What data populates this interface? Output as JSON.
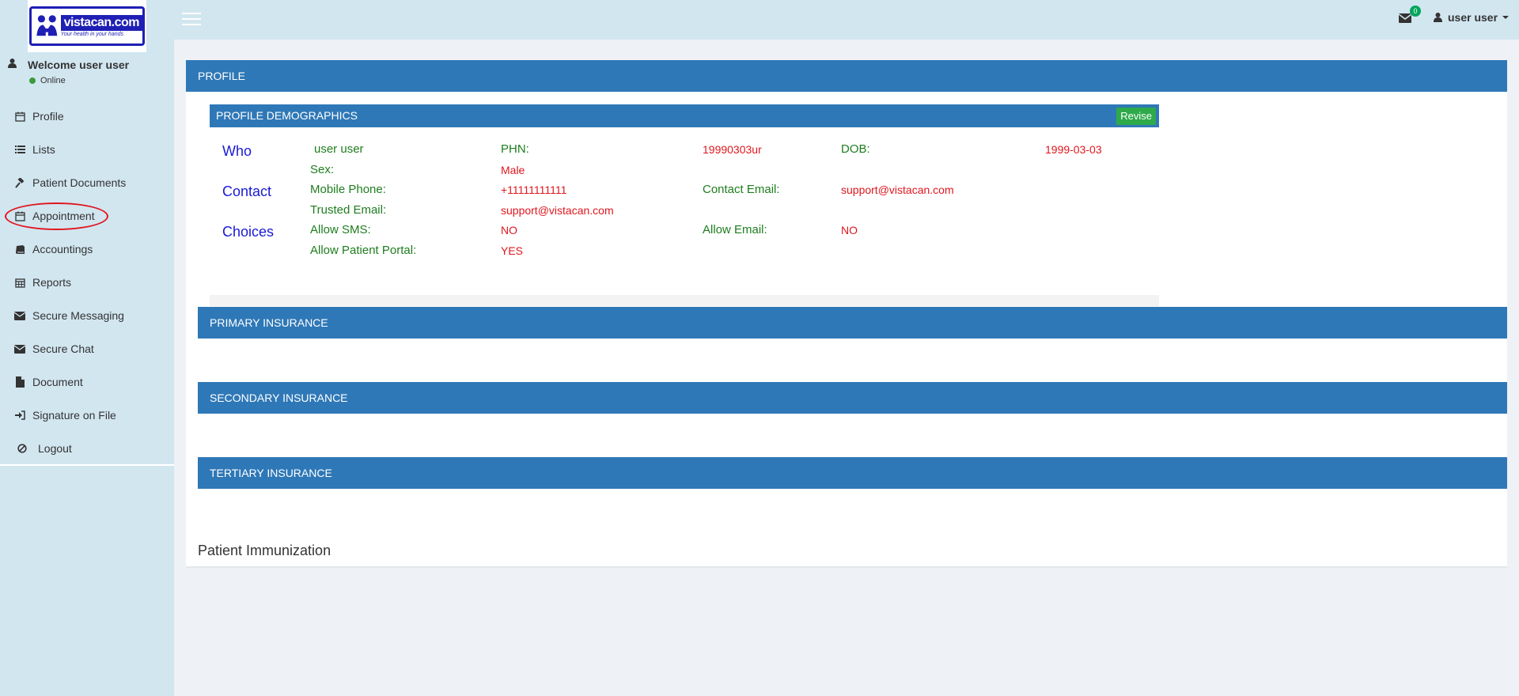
{
  "header": {
    "logo": {
      "brand": "vistacan.com",
      "tagline": "Your health in your hands"
    },
    "notifications_count": "0",
    "user_name": "user user"
  },
  "sidebar": {
    "welcome": "Welcome user user",
    "status": "Online",
    "items": [
      {
        "label": "Profile",
        "icon": "calendar-icon"
      },
      {
        "label": "Lists",
        "icon": "list-icon"
      },
      {
        "label": "Patient Documents",
        "icon": "gavel-icon"
      },
      {
        "label": "Appointment",
        "icon": "calendar-icon"
      },
      {
        "label": "Accountings",
        "icon": "book-icon"
      },
      {
        "label": "Reports",
        "icon": "calendar-grid-icon"
      },
      {
        "label": "Secure Messaging",
        "icon": "envelope-icon"
      },
      {
        "label": "Secure Chat",
        "icon": "envelope-icon"
      },
      {
        "label": "Document",
        "icon": "file-icon"
      },
      {
        "label": "Signature on File",
        "icon": "sign-in-icon"
      },
      {
        "label": "Logout",
        "icon": "ban-icon"
      }
    ]
  },
  "main": {
    "profile_title": "PROFILE",
    "demographics": {
      "title": "PROFILE DEMOGRAPHICS",
      "revise_label": "Revise",
      "sections": {
        "who": "Who",
        "contact": "Contact",
        "choices": "Choices"
      },
      "name": "user user",
      "fields": {
        "phn_label": "PHN:",
        "phn_value": "19990303ur",
        "dob_label": "DOB:",
        "dob_value": "1999-03-03",
        "sex_label": "Sex:",
        "sex_value": "Male",
        "mobile_label": "Mobile Phone:",
        "mobile_value": "+11111111111",
        "contact_email_label": "Contact Email:",
        "contact_email_value": "support@vistacan.com",
        "trusted_email_label": "Trusted Email:",
        "trusted_email_value": "support@vistacan.com",
        "allow_sms_label": "Allow SMS:",
        "allow_sms_value": "NO",
        "allow_email_label": "Allow Email:",
        "allow_email_value": "NO",
        "portal_label": "Allow Patient Portal:",
        "portal_value": "YES"
      }
    },
    "primary_insurance": "PRIMARY INSURANCE",
    "secondary_insurance": "SECONDARY INSURANCE",
    "tertiary_insurance": "TERTIARY INSURANCE",
    "immunization_title": "Patient Immunization"
  },
  "colors": {
    "header_bg": "#d2e6f0",
    "panel_blue": "#2f78b7",
    "label_green": "#1e7d1e",
    "value_red": "#e0161e",
    "section_blue": "#1a1ad6",
    "revise_green": "#2eaa4a",
    "highlight_red": "#e0161e"
  }
}
